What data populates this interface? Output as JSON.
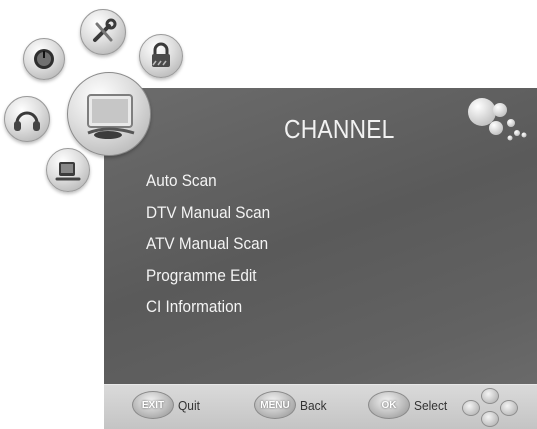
{
  "menu": {
    "title": "CHANNEL",
    "items": [
      {
        "label": "Auto Scan"
      },
      {
        "label": "DTV Manual Scan"
      },
      {
        "label": "ATV Manual Scan"
      },
      {
        "label": "Programme Edit"
      },
      {
        "label": "CI Information"
      }
    ]
  },
  "footer": {
    "exit_badge": "EXIT",
    "exit_label": "Quit",
    "menu_badge": "MENU",
    "menu_label": "Back",
    "ok_badge": "OK",
    "ok_label": "Select"
  },
  "icons": {
    "selected": "tv-channel-icon",
    "others": [
      "power-timer-icon",
      "tools-icon",
      "lock-icon",
      "audio-icon",
      "picture-icon"
    ]
  },
  "colors": {
    "panel": "#606060",
    "bar": "#cfcfcf",
    "text": "#f4f4f4"
  }
}
